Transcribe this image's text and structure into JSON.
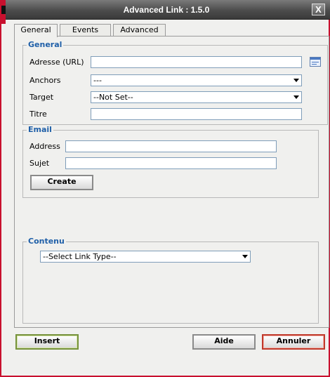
{
  "window": {
    "title": "Advanced Link : 1.5.0",
    "close_label": "X"
  },
  "tabs": [
    {
      "label": "General",
      "active": true
    },
    {
      "label": "Events",
      "active": false
    },
    {
      "label": "Advanced",
      "active": false
    }
  ],
  "general": {
    "legend": "General",
    "url_label": "Adresse (URL)",
    "url_value": "",
    "anchors_label": "Anchors",
    "anchors_value": "---",
    "target_label": "Target",
    "target_value": "--Not Set--",
    "title_label": "Titre",
    "title_value": ""
  },
  "email": {
    "legend": "Email",
    "address_label": "Address",
    "address_value": "",
    "subject_label": "Sujet",
    "subject_value": "",
    "create_label": "Create"
  },
  "content": {
    "legend": "Contenu",
    "link_type_value": "--Select Link Type--"
  },
  "footer": {
    "insert_label": "Insert",
    "help_label": "Aide",
    "cancel_label": "Annuler"
  },
  "icons": {
    "browse": "browse-list-icon",
    "dropdown": "chevron-down-icon"
  },
  "colors": {
    "legend_text": "#1f5fa8",
    "border_red": "#c8102e",
    "insert_border": "#76923c",
    "cancel_border": "#c0392b"
  }
}
